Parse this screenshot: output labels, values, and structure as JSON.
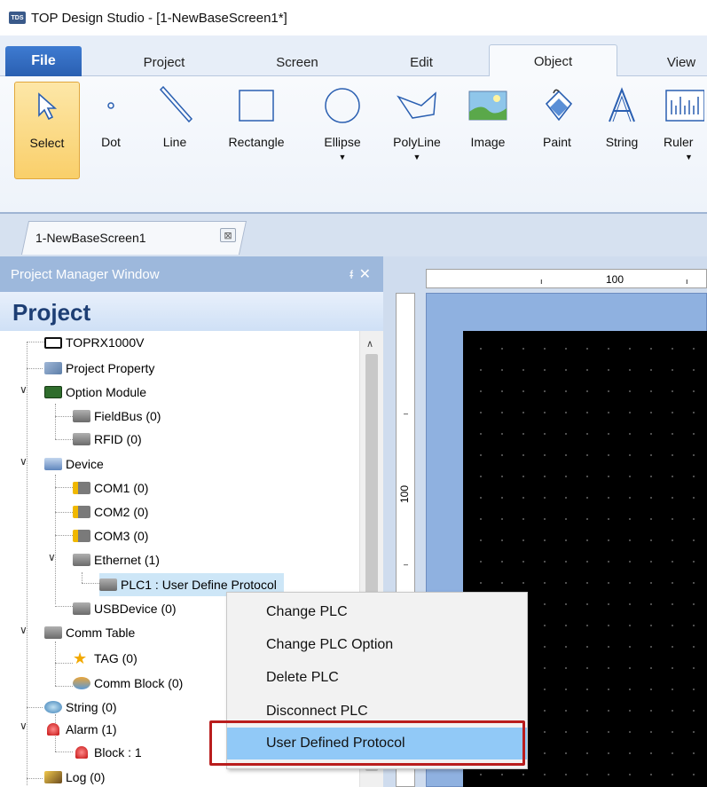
{
  "window": {
    "title": "TOP Design Studio - [1-NewBaseScreen1*]",
    "app_icon_text": "TDS"
  },
  "ribbon_tabs": {
    "file": "File",
    "tabs": [
      "Project",
      "Screen",
      "Edit",
      "Object",
      "View"
    ],
    "active": "Object"
  },
  "ribbon_buttons": {
    "select": "Select",
    "dot": "Dot",
    "line": "Line",
    "rectangle": "Rectangle",
    "ellipse": "Ellipse",
    "polyline": "PolyLine",
    "image": "Image",
    "paint": "Paint",
    "string": "String",
    "ruler": "Ruler"
  },
  "document_tab": {
    "label": "1-NewBaseScreen1",
    "close_glyph": "⊠"
  },
  "project_manager": {
    "header": "Project Manager Window",
    "pin": "ᵮ",
    "close": "✕",
    "title": "Project",
    "tree": {
      "toprx": "TOPRX1000V",
      "project_property": "Project Property",
      "option_module": "Option Module",
      "fieldbus": "FieldBus (0)",
      "rfid": "RFID (0)",
      "device": "Device",
      "com1": "COM1 (0)",
      "com2": "COM2 (0)",
      "com3": "COM3 (0)",
      "ethernet": "Ethernet (1)",
      "plc1": "PLC1 : User Define Protocol",
      "usbdevice": "USBDevice (0)",
      "comm_table": "Comm Table",
      "tag": "TAG (0)",
      "comm_block": "Comm Block (0)",
      "string": "String (0)",
      "alarm": "Alarm (1)",
      "block": "Block : 1",
      "log": "Log (0)"
    }
  },
  "ruler": {
    "top_label": "100",
    "left_label": "100"
  },
  "context_menu": {
    "items": [
      "Change PLC",
      "Change PLC Option",
      "Delete PLC",
      "Disconnect PLC",
      "User Defined Protocol"
    ],
    "highlighted": "User Defined Protocol"
  },
  "colors": {
    "accent": "#2a5fb1",
    "highlight_box": "#b91d1d",
    "menu_hover": "#91c9f7"
  }
}
